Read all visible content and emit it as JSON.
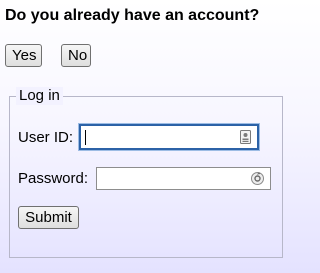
{
  "question": "Do you already have an account?",
  "account_choice": {
    "yes_label": "Yes",
    "no_label": "No"
  },
  "login": {
    "legend": "Log in",
    "userid_label": "User ID:",
    "userid_value": "",
    "userid_icon": "id-card-icon",
    "password_label": "Password:",
    "password_value": "",
    "password_icon": "password-reveal-icon",
    "submit_label": "Submit"
  },
  "colors": {
    "focus_border": "#2c62a7",
    "background_bottom": "#e4e2ff"
  }
}
